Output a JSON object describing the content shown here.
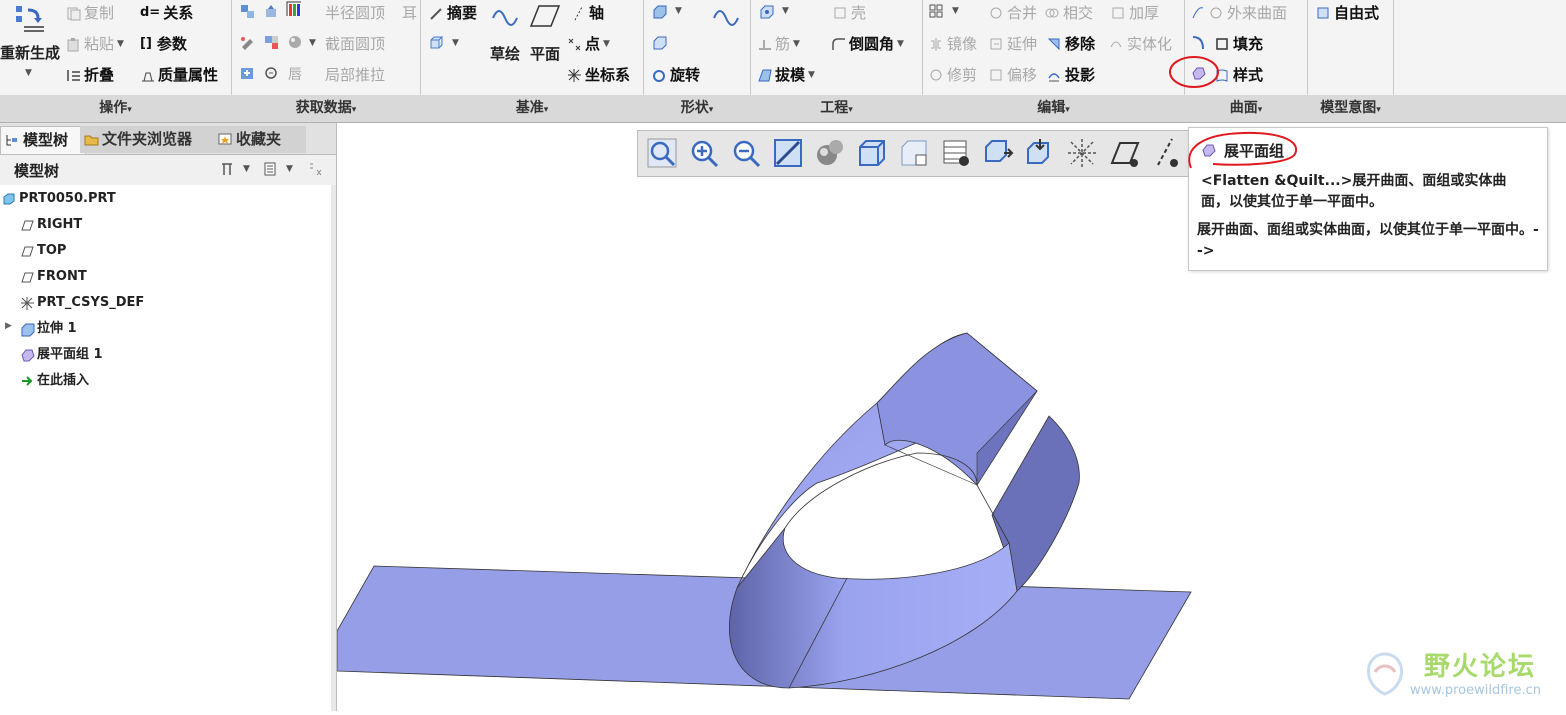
{
  "ribbon": {
    "operations": {
      "label": "操作",
      "regenerate": "重新生成",
      "copy": "复制",
      "paste": "粘贴",
      "fold": "折叠",
      "relations": "关系",
      "parameters": "参数",
      "mass_properties": "质量属性"
    },
    "get_data": {
      "label": "获取数据",
      "radius_dome": "半径圆顶",
      "ear": "耳",
      "section_dome": "截面圆顶",
      "lip": "唇",
      "local_push": "局部推拉"
    },
    "datum": {
      "label": "基准",
      "summary": "摘要",
      "axis": "轴",
      "point": "点",
      "csys": "坐标系",
      "sketch": "草绘",
      "plane": "平面"
    },
    "shapes": {
      "label": "形状",
      "revolve": "旋转"
    },
    "engineering": {
      "label": "工程",
      "shell": "壳",
      "rib": "筋",
      "round": "倒圆角",
      "draft": "拔模"
    },
    "editing": {
      "label": "编辑",
      "merge": "合并",
      "intersect": "相交",
      "thicken": "加厚",
      "mirror": "镜像",
      "extend": "延伸",
      "remove": "移除",
      "solidify": "实体化",
      "trim": "修剪",
      "offset": "偏移",
      "project": "投影"
    },
    "surfaces": {
      "label": "曲面",
      "boundary": "外来曲面",
      "fill": "填充",
      "style": "样式"
    },
    "model_intent": {
      "label": "模型意图",
      "freestyle": "自由式"
    }
  },
  "panel": {
    "tabs": [
      "模型树",
      "文件夹浏览器",
      "收藏夹"
    ],
    "tree_header": "模型树",
    "tree": [
      {
        "label": "PRT0050.PRT",
        "icon": "part-icon"
      },
      {
        "label": "RIGHT",
        "icon": "datum-plane-icon"
      },
      {
        "label": "TOP",
        "icon": "datum-plane-icon"
      },
      {
        "label": "FRONT",
        "icon": "datum-plane-icon"
      },
      {
        "label": "PRT_CSYS_DEF",
        "icon": "csys-icon"
      },
      {
        "label": "拉伸 1",
        "icon": "extrude-icon"
      },
      {
        "label": "展平面组 1",
        "icon": "flatten-quilt-icon"
      },
      {
        "label": "在此插入",
        "icon": "insert-here-icon"
      }
    ]
  },
  "tooltip": {
    "title": "展平面组",
    "description": "<Flatten &Quilt...>展开曲面、面组或实体曲面，以使其位于单一平面中。",
    "description2": "展开曲面、面组或实体曲面，以使其位于单一平面中。-->"
  },
  "watermark": {
    "name": "野火论坛",
    "url": "www.proewildfire.cn"
  },
  "colors": {
    "surface": "#9aa3ee",
    "surface_dark": "#6d74bd",
    "annotation": "#e0191f"
  }
}
